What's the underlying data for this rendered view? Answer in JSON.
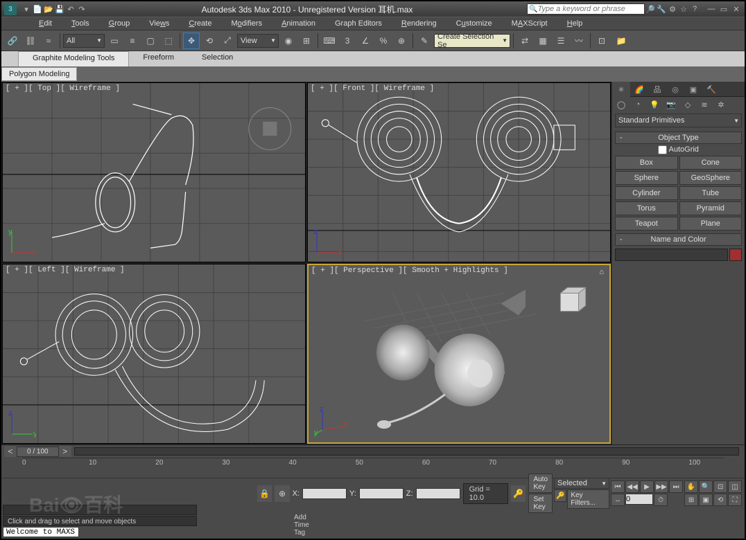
{
  "title": "Autodesk 3ds Max 2010  - Unregistered Version    耳机.max",
  "search_placeholder": "Type a keyword or phrase",
  "menus": [
    "Edit",
    "Tools",
    "Group",
    "Views",
    "Create",
    "Modifiers",
    "Animation",
    "Graph Editors",
    "Rendering",
    "Customize",
    "MAXScript",
    "Help"
  ],
  "toolbar": {
    "filter_drop": "All",
    "view_drop": "View",
    "selset_drop": "Create Selection Se"
  },
  "ribbon": {
    "tabs": [
      "Graphite Modeling Tools",
      "Freeform",
      "Selection"
    ],
    "subtab": "Polygon Modeling"
  },
  "viewports": [
    {
      "label": "[ + ][ Top ][ Wireframe ]"
    },
    {
      "label": "[ + ][ Front ][ Wireframe ]"
    },
    {
      "label": "[ + ][ Left ][ Wireframe ]"
    },
    {
      "label": "[ + ][ Perspective ][ Smooth + Highlights ]"
    }
  ],
  "panel": {
    "category_drop": "Standard Primitives",
    "rollout1": "Object Type",
    "autogrid": "AutoGrid",
    "primitives": [
      "Box",
      "Cone",
      "Sphere",
      "GeoSphere",
      "Cylinder",
      "Tube",
      "Torus",
      "Pyramid",
      "Teapot",
      "Plane"
    ],
    "rollout2": "Name and Color"
  },
  "timeline": {
    "slider": "0 / 100",
    "ticks": [
      "0",
      "10",
      "20",
      "30",
      "40",
      "50",
      "60",
      "70",
      "80",
      "90",
      "100"
    ]
  },
  "status": {
    "welcome": "Welcome to MAXS",
    "prompt": "Click and drag to select and move objects",
    "x": "X:",
    "y": "Y:",
    "z": "Z:",
    "grid": "Grid = 10.0",
    "addtag": "Add Time Tag",
    "autokey": "Auto Key",
    "setkey": "Set Key",
    "selected": "Selected",
    "keyfilters": "Key Filters..."
  }
}
